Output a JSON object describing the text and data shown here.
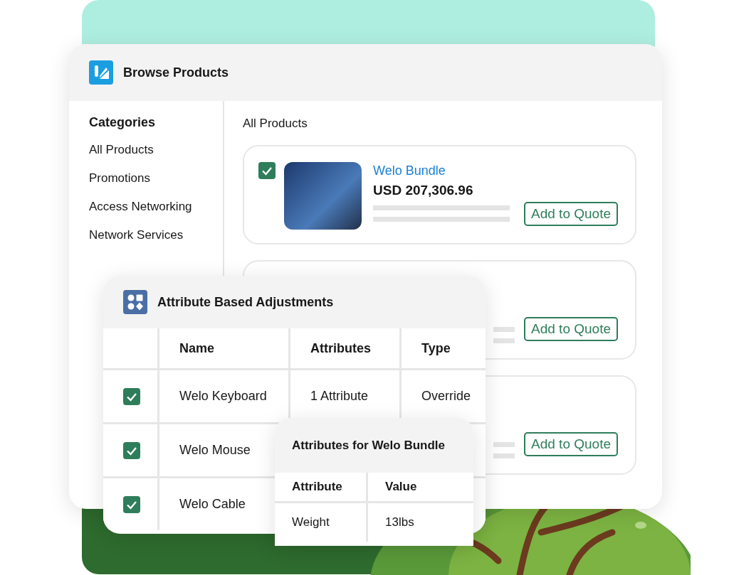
{
  "browse_window": {
    "title": "Browse Products",
    "sidebar": {
      "heading": "Categories",
      "items": [
        "All Products",
        "Promotions",
        "Access Networking",
        "Network Services"
      ]
    },
    "section_title": "All Products",
    "products": [
      {
        "checked": true,
        "title": "Welo Bundle",
        "price": "USD 207,306.96",
        "button": "Add to Quote"
      },
      {
        "button": "Add to Quote"
      },
      {
        "button": "Add to Quote"
      }
    ]
  },
  "adjustments_window": {
    "title": "Attribute Based Adjustments",
    "columns": [
      "Name",
      "Attributes",
      "Type"
    ],
    "rows": [
      {
        "checked": true,
        "name": "Welo Keyboard",
        "attributes": "1 Attribute",
        "type": "Override"
      },
      {
        "checked": true,
        "name": "Welo Mouse"
      },
      {
        "checked": true,
        "name": "Welo Cable"
      }
    ]
  },
  "attributes_popup": {
    "title": "Attributes for Welo Bundle",
    "columns": [
      "Attribute",
      "Value"
    ],
    "rows": [
      [
        "Weight",
        "13lbs"
      ]
    ]
  }
}
